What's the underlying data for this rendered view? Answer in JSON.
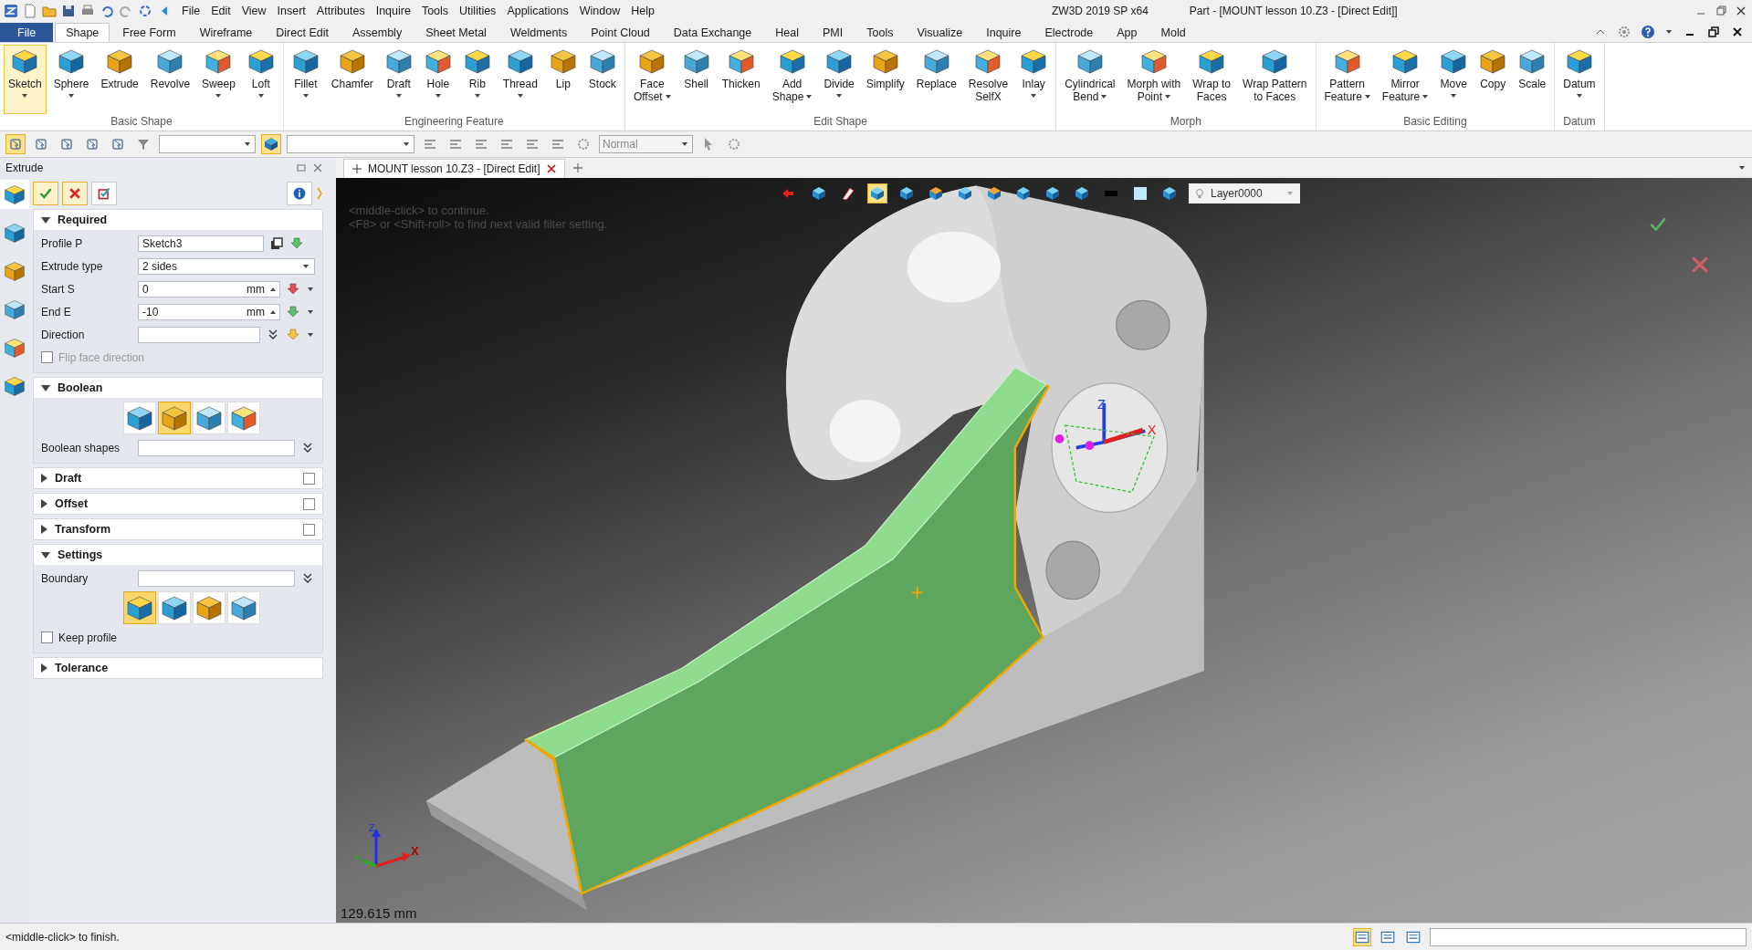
{
  "title_bar": {
    "app": "ZW3D 2019 SP x64",
    "document": "Part - [MOUNT lesson 10.Z3 - [Direct Edit]]"
  },
  "menu": [
    "File",
    "Edit",
    "View",
    "Insert",
    "Attributes",
    "Inquire",
    "Tools",
    "Utilities",
    "Applications",
    "Window",
    "Help"
  ],
  "ribbon_tabs": [
    {
      "label": "File",
      "kind": "file",
      "selected": false
    },
    {
      "label": "Shape",
      "kind": "tab",
      "selected": true
    },
    {
      "label": "Free Form",
      "kind": "tab",
      "selected": false
    },
    {
      "label": "Wireframe",
      "kind": "tab",
      "selected": false
    },
    {
      "label": "Direct Edit",
      "kind": "tab",
      "selected": false
    },
    {
      "label": "Assembly",
      "kind": "tab",
      "selected": false
    },
    {
      "label": "Sheet Metal",
      "kind": "tab",
      "selected": false
    },
    {
      "label": "Weldments",
      "kind": "tab",
      "selected": false
    },
    {
      "label": "Point Cloud",
      "kind": "tab",
      "selected": false
    },
    {
      "label": "Data Exchange",
      "kind": "tab",
      "selected": false
    },
    {
      "label": "Heal",
      "kind": "tab",
      "selected": false
    },
    {
      "label": "PMI",
      "kind": "tab",
      "selected": false
    },
    {
      "label": "Tools",
      "kind": "tab",
      "selected": false
    },
    {
      "label": "Visualize",
      "kind": "tab",
      "selected": false
    },
    {
      "label": "Inquire",
      "kind": "tab",
      "selected": false
    },
    {
      "label": "Electrode",
      "kind": "tab",
      "selected": false
    },
    {
      "label": "App",
      "kind": "tab",
      "selected": false
    },
    {
      "label": "Mold",
      "kind": "tab",
      "selected": false
    }
  ],
  "ribbon_groups": [
    {
      "label": "Basic Shape",
      "buttons": [
        {
          "lines": [
            "Sketch"
          ],
          "dropdown": true,
          "selected": true
        },
        {
          "lines": [
            "Sphere"
          ],
          "dropdown": true,
          "selected": false
        },
        {
          "lines": [
            "Extrude"
          ],
          "dropdown": false,
          "selected": false
        },
        {
          "lines": [
            "Revolve"
          ],
          "dropdown": false,
          "selected": false
        },
        {
          "lines": [
            "Sweep"
          ],
          "dropdown": true,
          "selected": false
        },
        {
          "lines": [
            "Loft"
          ],
          "dropdown": true,
          "selected": false
        }
      ]
    },
    {
      "label": "Engineering Feature",
      "buttons": [
        {
          "lines": [
            "Fillet"
          ],
          "dropdown": true,
          "selected": false
        },
        {
          "lines": [
            "Chamfer"
          ],
          "dropdown": false,
          "selected": false
        },
        {
          "lines": [
            "Draft"
          ],
          "dropdown": true,
          "selected": false
        },
        {
          "lines": [
            "Hole"
          ],
          "dropdown": true,
          "selected": false
        },
        {
          "lines": [
            "Rib"
          ],
          "dropdown": true,
          "selected": false
        },
        {
          "lines": [
            "Thread"
          ],
          "dropdown": true,
          "selected": false
        },
        {
          "lines": [
            "Lip"
          ],
          "dropdown": false,
          "selected": false
        },
        {
          "lines": [
            "Stock"
          ],
          "dropdown": false,
          "selected": false
        }
      ]
    },
    {
      "label": "Edit Shape",
      "buttons": [
        {
          "lines": [
            "Face",
            "Offset"
          ],
          "dropdown": true,
          "selected": false
        },
        {
          "lines": [
            "Shell"
          ],
          "dropdown": false,
          "selected": false
        },
        {
          "lines": [
            "Thicken"
          ],
          "dropdown": false,
          "selected": false
        },
        {
          "lines": [
            "Add",
            "Shape"
          ],
          "dropdown": true,
          "selected": false
        },
        {
          "lines": [
            "Divide"
          ],
          "dropdown": true,
          "selected": false
        },
        {
          "lines": [
            "Simplify"
          ],
          "dropdown": false,
          "selected": false
        },
        {
          "lines": [
            "Replace"
          ],
          "dropdown": false,
          "selected": false
        },
        {
          "lines": [
            "Resolve",
            "SelfX"
          ],
          "dropdown": false,
          "selected": false
        },
        {
          "lines": [
            "Inlay"
          ],
          "dropdown": true,
          "selected": false
        }
      ]
    },
    {
      "label": "Morph",
      "buttons": [
        {
          "lines": [
            "Cylindrical",
            "Bend"
          ],
          "dropdown": true,
          "selected": false
        },
        {
          "lines": [
            "Morph with",
            "Point"
          ],
          "dropdown": true,
          "selected": false
        },
        {
          "lines": [
            "Wrap to",
            "Faces"
          ],
          "dropdown": false,
          "selected": false
        },
        {
          "lines": [
            "Wrap Pattern",
            "to Faces"
          ],
          "dropdown": false,
          "selected": false
        }
      ]
    },
    {
      "label": "Basic Editing",
      "buttons": [
        {
          "lines": [
            "Pattern",
            "Feature"
          ],
          "dropdown": true,
          "selected": false
        },
        {
          "lines": [
            "Mirror",
            "Feature"
          ],
          "dropdown": true,
          "selected": false
        },
        {
          "lines": [
            "Move"
          ],
          "dropdown": true,
          "selected": false
        },
        {
          "lines": [
            "Copy"
          ],
          "dropdown": false,
          "selected": false
        },
        {
          "lines": [
            "Scale"
          ],
          "dropdown": false,
          "selected": false
        }
      ]
    },
    {
      "label": "Datum",
      "buttons": [
        {
          "lines": [
            "Datum"
          ],
          "dropdown": true,
          "selected": false
        }
      ]
    }
  ],
  "toolbar": {
    "tools": [
      {
        "selected": true
      },
      {
        "selected": false
      },
      {
        "selected": false
      },
      {
        "selected": false
      },
      {
        "selected": false
      }
    ],
    "filter_icon": {
      "selected": true
    },
    "filter_value": "Normal"
  },
  "side_tabs": [
    {
      "selected": true
    },
    {
      "selected": false
    },
    {
      "selected": false
    },
    {
      "selected": false
    },
    {
      "selected": false
    },
    {
      "selected": false
    }
  ],
  "panel": {
    "title": "Extrude",
    "sections": [
      {
        "title": "Required",
        "expanded": true,
        "rows": [
          {
            "kind": "pick",
            "label": "Profile P",
            "value": "Sketch3"
          },
          {
            "kind": "select",
            "label": "Extrude type",
            "value": "2 sides"
          },
          {
            "kind": "number",
            "label": "Start S",
            "value": "0",
            "unit": "mm"
          },
          {
            "kind": "number",
            "label": "End E",
            "value": "-10",
            "unit": "mm"
          },
          {
            "kind": "vector",
            "label": "Direction"
          },
          {
            "kind": "checkbox",
            "label": "Flip face direction",
            "checked": false,
            "disabled": true
          }
        ]
      },
      {
        "title": "Boolean",
        "expanded": true,
        "rows": [
          {
            "kind": "icons",
            "options": [
              {
                "selected": false
              },
              {
                "selected": true
              },
              {
                "selected": false
              },
              {
                "selected": false
              }
            ]
          },
          {
            "kind": "list",
            "label": "Boolean shapes"
          }
        ]
      },
      {
        "title": "Draft",
        "expanded": false,
        "checked": false
      },
      {
        "title": "Offset",
        "expanded": false,
        "checked": false
      },
      {
        "title": "Transform",
        "expanded": false,
        "checked": false
      },
      {
        "title": "Settings",
        "expanded": true,
        "rows": [
          {
            "kind": "list",
            "label": "Boundary"
          },
          {
            "kind": "icons",
            "options": [
              {
                "selected": true
              },
              {
                "selected": false
              },
              {
                "selected": false
              },
              {
                "selected": false
              }
            ]
          },
          {
            "kind": "checkbox",
            "label": "Keep profile",
            "checked": false,
            "disabled": false
          }
        ]
      },
      {
        "title": "Tolerance",
        "expanded": false
      }
    ]
  },
  "document_tab": {
    "title": "MOUNT lesson 10.Z3 - [Direct Edit]"
  },
  "viewport": {
    "hints": [
      "<middle-click> to continue.",
      "<F8> or <Shift-roll> to find next valid filter setting."
    ],
    "view_tools": [
      {
        "selected": false
      },
      {
        "selected": false
      },
      {
        "selected": false
      },
      {
        "selected": true
      },
      {
        "selected": false
      },
      {
        "selected": false
      },
      {
        "selected": false
      },
      {
        "selected": false
      },
      {
        "selected": false
      },
      {
        "selected": false
      },
      {
        "selected": false
      },
      {
        "selected": false
      },
      {
        "selected": false
      },
      {
        "selected": false
      }
    ],
    "layer": "Layer0000",
    "gizmo_labels": [
      "Z",
      "X"
    ],
    "axis_labels": [
      "Z",
      "Y",
      "X"
    ],
    "measurement": "129.615 mm"
  },
  "status_bar": {
    "message": "<middle-click> to finish.",
    "tools": [
      {
        "selected": true
      },
      {
        "selected": false
      },
      {
        "selected": false
      }
    ]
  }
}
